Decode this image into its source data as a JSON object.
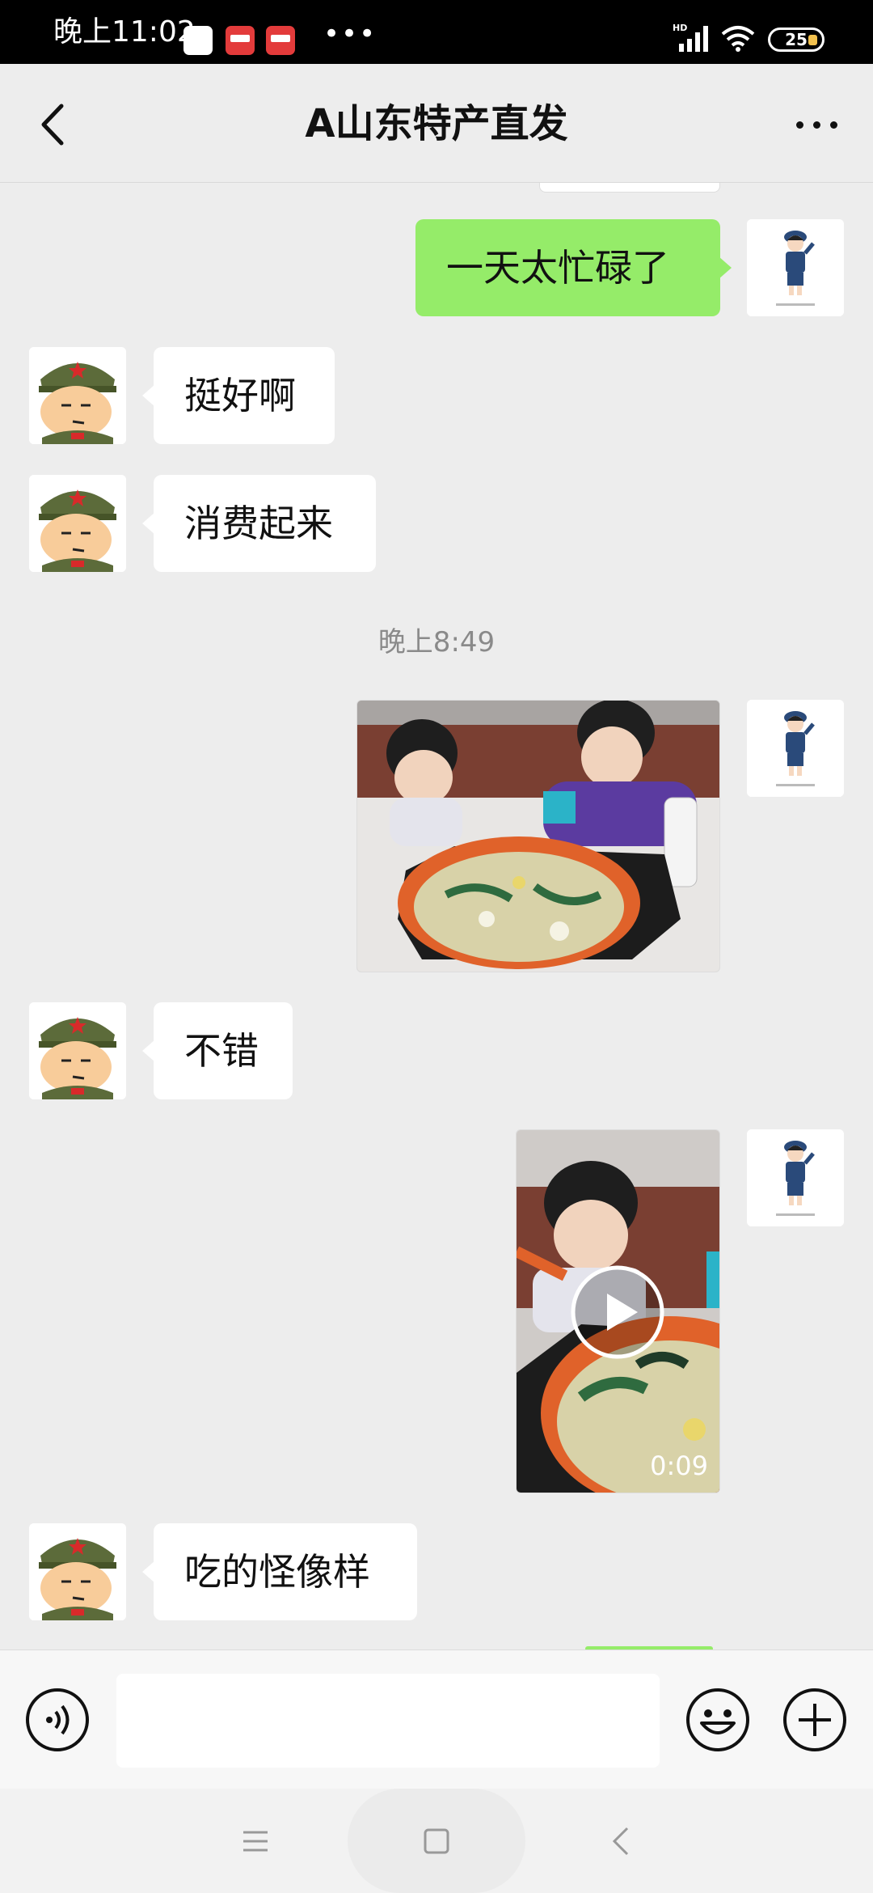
{
  "status_bar": {
    "time": "晚上11:02",
    "overflow_indicator": "•••",
    "network_label": "HD",
    "battery_level": "25"
  },
  "header": {
    "back_icon": "chevron-left-icon",
    "title": "A山东特产直发",
    "more_icon": "more-dots-icon"
  },
  "messages": [
    {
      "side": "right",
      "type": "text",
      "text": "一天太忙碌了"
    },
    {
      "side": "left",
      "type": "text",
      "text": "挺好啊"
    },
    {
      "side": "left",
      "type": "text",
      "text": "消费起来"
    },
    {
      "type": "timestamp",
      "text": "晚上8:49"
    },
    {
      "side": "right",
      "type": "image",
      "icon": "photo-kids-eating"
    },
    {
      "side": "left",
      "type": "text",
      "text": "不错"
    },
    {
      "side": "right",
      "type": "video",
      "duration": "0:09",
      "icon": "play-icon"
    },
    {
      "side": "left",
      "type": "text",
      "text": "吃的怪像样"
    }
  ],
  "input_bar": {
    "voice_icon": "voice-icon",
    "input_value": "",
    "emoji_icon": "emoji-icon",
    "plus_icon": "plus-icon"
  },
  "nav_bar": {
    "menu_icon": "menu-icon",
    "home_icon": "home-icon",
    "back_icon": "back-icon"
  },
  "colors": {
    "sent_bubble": "#95ec69",
    "received_bubble": "#ffffff",
    "background": "#ededed"
  }
}
